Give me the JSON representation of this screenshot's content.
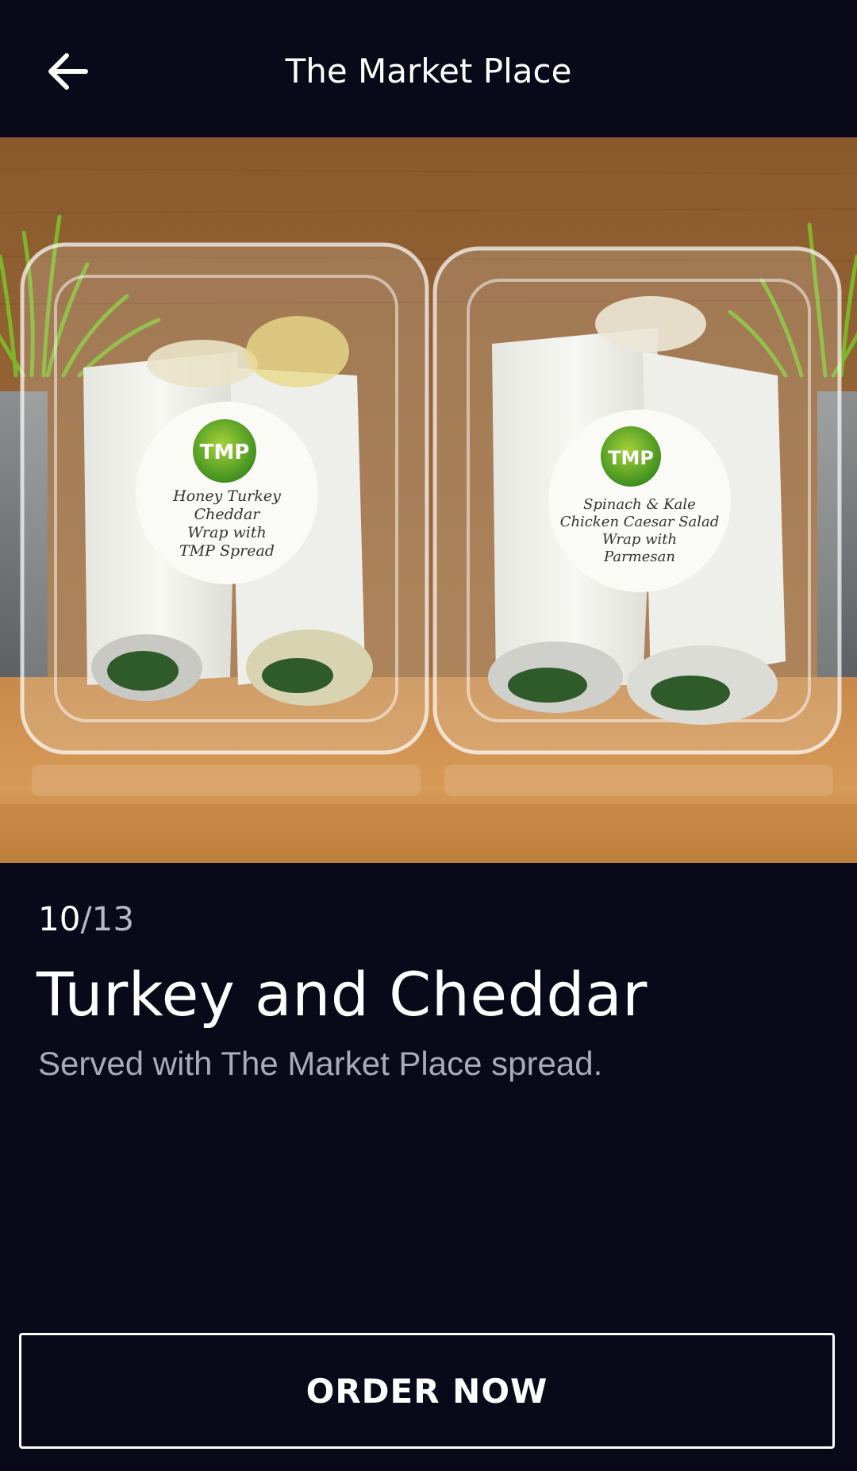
{
  "header": {
    "title": "The Market Place",
    "back_icon": "arrow-left-icon"
  },
  "hero": {
    "left_label": {
      "brand": "TMP",
      "lines": [
        "Honey Turkey",
        "Cheddar",
        "Wrap with",
        "TMP Spread"
      ]
    },
    "right_label": {
      "brand": "TMP",
      "lines": [
        "Spinach & Kale",
        "Chicken Caesar Salad",
        "Wrap with",
        "Parmesan"
      ]
    }
  },
  "item": {
    "index": "10",
    "separator": "/",
    "total": "13",
    "title": "Turkey and Cheddar",
    "description": "Served with The Market Place spread."
  },
  "actions": {
    "order_label": "ORDER NOW"
  },
  "colors": {
    "background": "#090919",
    "text": "#ffffff",
    "muted_text": "#a9a9b8"
  }
}
